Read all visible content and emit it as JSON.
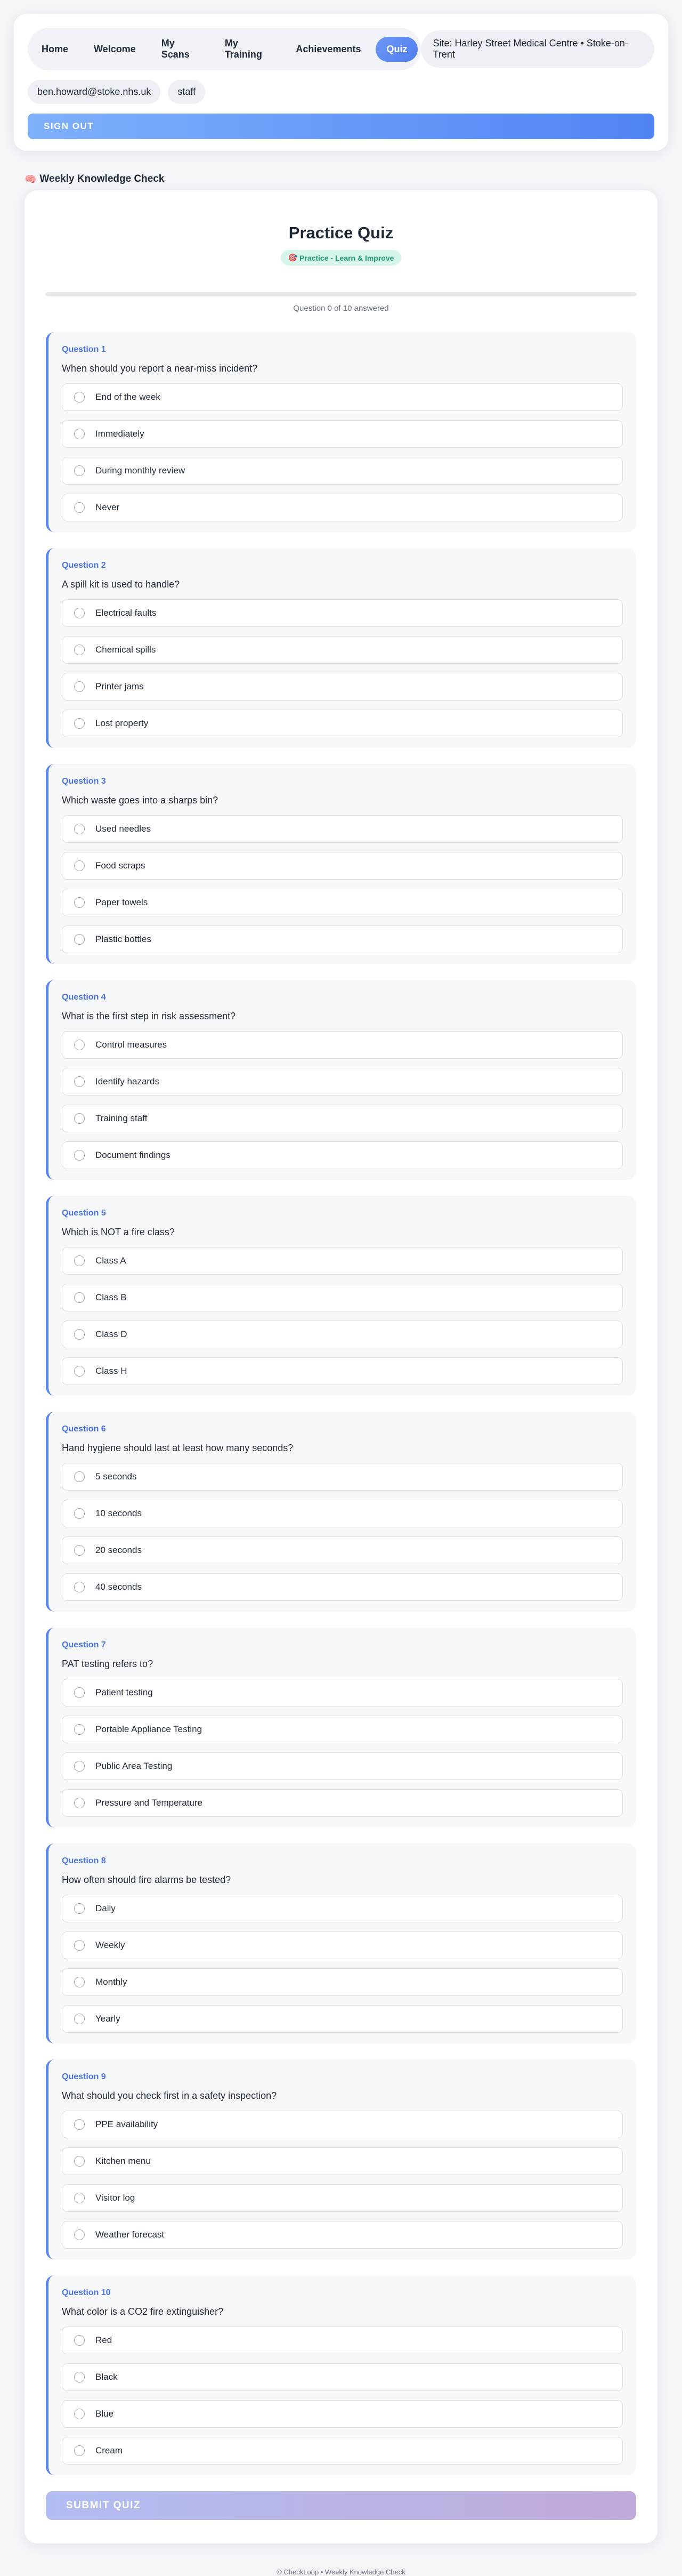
{
  "nav": {
    "items": [
      {
        "label": "Home",
        "active": false
      },
      {
        "label": "Welcome",
        "active": false
      },
      {
        "label": "My Scans",
        "active": false
      },
      {
        "label": "My Training",
        "active": false
      },
      {
        "label": "Achievements",
        "active": false
      },
      {
        "label": "Quiz",
        "active": true
      }
    ],
    "site": "Site: Harley Street Medical Centre • Stoke-on-Trent"
  },
  "user": {
    "email": "ben.howard@stoke.nhs.uk",
    "role": "staff"
  },
  "signout_label": "SIGN OUT",
  "section": {
    "icon": "brain-icon",
    "icon_glyph": "🧠",
    "title": "Weekly Knowledge Check"
  },
  "quiz": {
    "title": "Practice Quiz",
    "badge_glyph": "🎯",
    "badge": "Practice - Learn & Improve",
    "progress_fraction": 0,
    "progress_text": "Question 0 of 10 answered",
    "questions": [
      {
        "number": "Question 1",
        "text": "When should you report a near-miss incident?",
        "options": [
          "End of the week",
          "Immediately",
          "During monthly review",
          "Never"
        ]
      },
      {
        "number": "Question 2",
        "text": "A spill kit is used to handle?",
        "options": [
          "Electrical faults",
          "Chemical spills",
          "Printer jams",
          "Lost property"
        ]
      },
      {
        "number": "Question 3",
        "text": "Which waste goes into a sharps bin?",
        "options": [
          "Used needles",
          "Food scraps",
          "Paper towels",
          "Plastic bottles"
        ]
      },
      {
        "number": "Question 4",
        "text": "What is the first step in risk assessment?",
        "options": [
          "Control measures",
          "Identify hazards",
          "Training staff",
          "Document findings"
        ]
      },
      {
        "number": "Question 5",
        "text": "Which is NOT a fire class?",
        "options": [
          "Class A",
          "Class B",
          "Class D",
          "Class H"
        ]
      },
      {
        "number": "Question 6",
        "text": "Hand hygiene should last at least how many seconds?",
        "options": [
          "5 seconds",
          "10 seconds",
          "20 seconds",
          "40 seconds"
        ]
      },
      {
        "number": "Question 7",
        "text": "PAT testing refers to?",
        "options": [
          "Patient testing",
          "Portable Appliance Testing",
          "Public Area Testing",
          "Pressure and Temperature"
        ]
      },
      {
        "number": "Question 8",
        "text": "How often should fire alarms be tested?",
        "options": [
          "Daily",
          "Weekly",
          "Monthly",
          "Yearly"
        ]
      },
      {
        "number": "Question 9",
        "text": "What should you check first in a safety inspection?",
        "options": [
          "PPE availability",
          "Kitchen menu",
          "Visitor log",
          "Weather forecast"
        ]
      },
      {
        "number": "Question 10",
        "text": "What color is a CO2 fire extinguisher?",
        "options": [
          "Red",
          "Black",
          "Blue",
          "Cream"
        ]
      }
    ],
    "submit_label": "SUBMIT QUIZ"
  },
  "footer": "© CheckLoop • Weekly Knowledge Check",
  "colors": {
    "accent": "#5b84f3",
    "badge_bg": "#d6f5ea",
    "badge_text": "#1f9b74"
  }
}
